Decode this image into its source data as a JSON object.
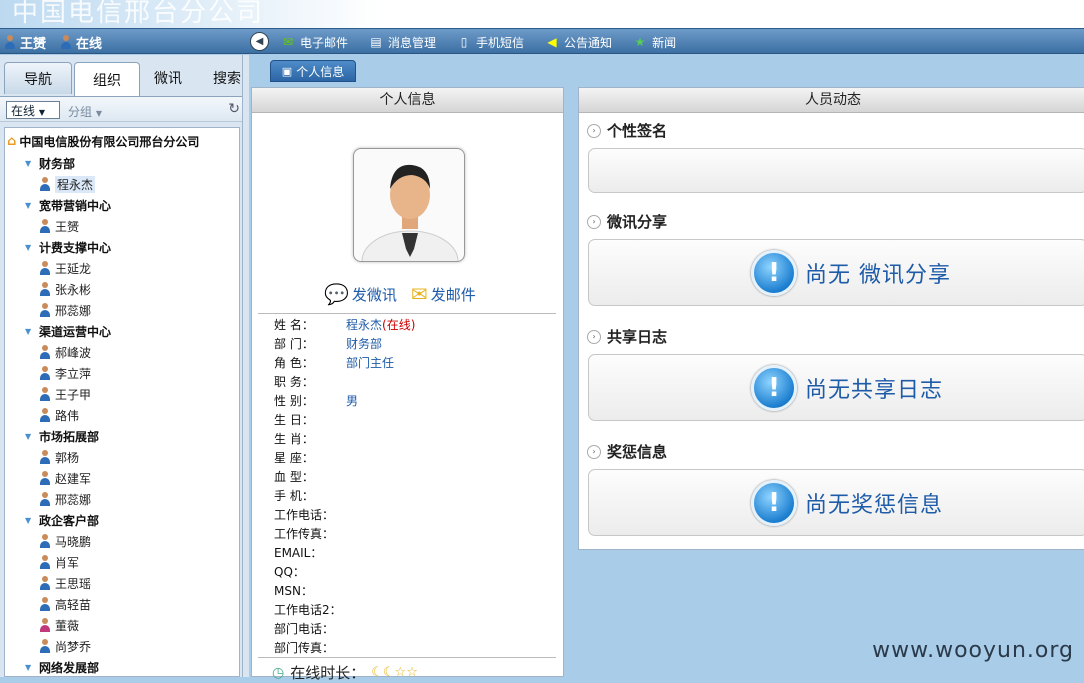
{
  "banner": {
    "title": "中国电信邢台分公司"
  },
  "user": {
    "name": "王赟",
    "status": "在线"
  },
  "menu": [
    "电子邮件",
    "消息管理",
    "手机短信",
    "公告通知",
    "新闻"
  ],
  "left_tabs": [
    "导航",
    "组织",
    "微讯",
    "搜索"
  ],
  "filter": {
    "status": "在线",
    "group": "分组"
  },
  "tree": {
    "root": "中国电信股份有限公司邢台分公司",
    "depts": [
      {
        "name": "财务部",
        "members": [
          "程永杰"
        ]
      },
      {
        "name": "宽带营销中心",
        "members": [
          "王赟"
        ]
      },
      {
        "name": "计费支撑中心",
        "members": [
          "王延龙",
          "张永彬",
          "邢蕊娜"
        ]
      },
      {
        "name": "渠道运营中心",
        "members": [
          "郝峰波",
          "李立萍",
          "王子甲",
          "路伟"
        ]
      },
      {
        "name": "市场拓展部",
        "members": [
          "郭杨",
          "赵建军",
          "邢蕊娜"
        ]
      },
      {
        "name": "政企客户部",
        "members": [
          "马晓鹏",
          "肖军",
          "王思瑶",
          "高轻苗",
          "董薇",
          "尚梦乔"
        ]
      },
      {
        "name": "网络发展部",
        "members": []
      }
    ]
  },
  "content_tab": "个人信息",
  "info_panel": {
    "title": "个人信息",
    "send_msg": "发微讯",
    "send_mail": "发邮件",
    "fields": [
      {
        "label": "姓 名：",
        "value": "程永杰",
        "extra": "(在线)"
      },
      {
        "label": "部 门：",
        "value": "财务部"
      },
      {
        "label": "角 色：",
        "value": "部门主任"
      },
      {
        "label": "职 务：",
        "value": ""
      },
      {
        "label": "性 别：",
        "value": "男"
      },
      {
        "label": "生 日：",
        "value": ""
      },
      {
        "label": "生 肖：",
        "value": ""
      },
      {
        "label": "星 座：",
        "value": ""
      },
      {
        "label": "血 型：",
        "value": ""
      },
      {
        "label": "手 机：",
        "value": ""
      },
      {
        "label": "工作电话：",
        "value": ""
      },
      {
        "label": "工作传真：",
        "value": ""
      },
      {
        "label": "EMAIL：",
        "value": ""
      },
      {
        "label": "QQ：",
        "value": ""
      },
      {
        "label": "MSN：",
        "value": ""
      },
      {
        "label": "工作电话2：",
        "value": ""
      },
      {
        "label": "部门电话：",
        "value": ""
      },
      {
        "label": "部门传真：",
        "value": ""
      }
    ],
    "online_time_label": "在线时长："
  },
  "activity_panel": {
    "title": "人员动态",
    "sections": [
      {
        "title": "个性签名",
        "empty": ""
      },
      {
        "title": "微讯分享",
        "empty": "尚无 微讯分享"
      },
      {
        "title": "共享日志",
        "empty": "尚无共享日志"
      },
      {
        "title": "奖惩信息",
        "empty": "尚无奖惩信息"
      }
    ]
  },
  "watermark": "www.wooyun.org"
}
